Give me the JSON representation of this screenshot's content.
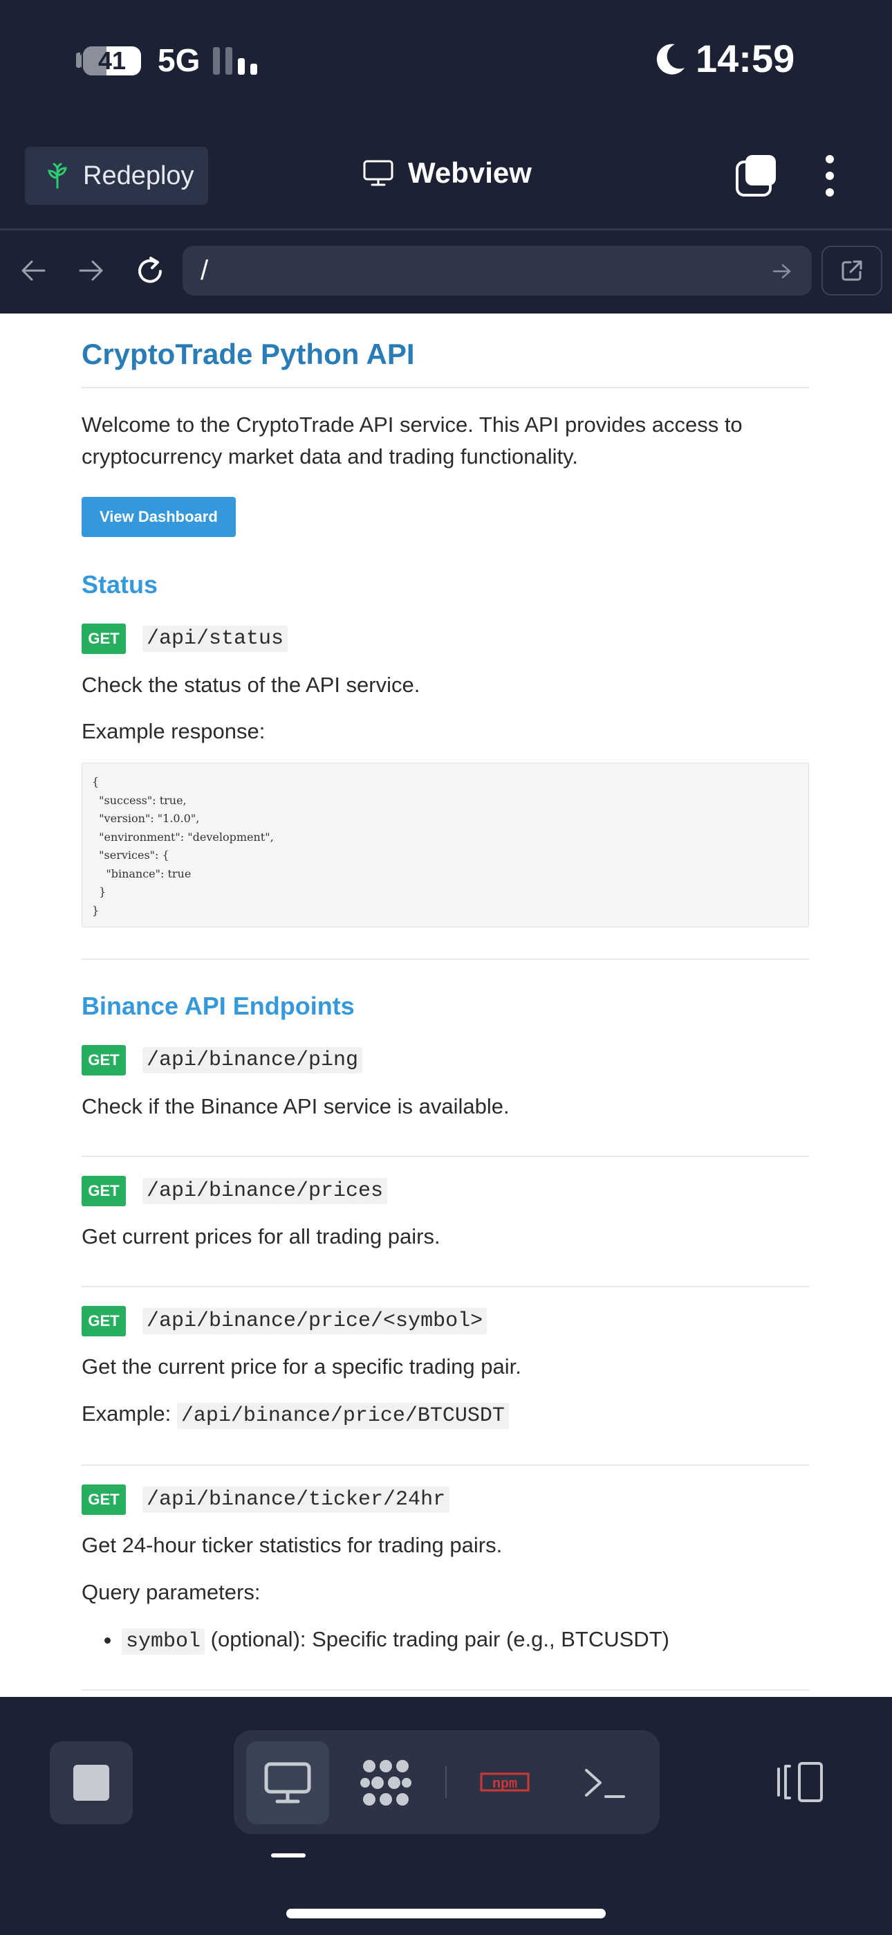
{
  "status_bar": {
    "battery": "41",
    "network": "5G",
    "time": "14:59"
  },
  "header": {
    "redeploy_label": "Redeploy",
    "title": "Webview"
  },
  "address": {
    "url": "/"
  },
  "page": {
    "title": "CryptoTrade Python API",
    "intro": "Welcome to the CryptoTrade API service. This API provides access to cryptocurrency market data and trading functionality.",
    "dashboard_button": "View Dashboard",
    "status_section": {
      "heading": "Status",
      "method": "GET",
      "path": "/api/status",
      "description": "Check the status of the API service.",
      "example_label": "Example response:",
      "example_json": "{\n  \"success\": true,\n  \"version\": \"1.0.0\",\n  \"environment\": \"development\",\n  \"services\": {\n    \"binance\": true\n  }\n}"
    },
    "binance_section": {
      "heading": "Binance API Endpoints",
      "endpoints": [
        {
          "method": "GET",
          "path": "/api/binance/ping",
          "description": "Check if the Binance API service is available."
        },
        {
          "method": "GET",
          "path": "/api/binance/prices",
          "description": "Get current prices for all trading pairs."
        },
        {
          "method": "GET",
          "path": "/api/binance/price/<symbol>",
          "description": "Get the current price for a specific trading pair.",
          "example_label": "Example:",
          "example_path": "/api/binance/price/BTCUSDT"
        },
        {
          "method": "GET",
          "path": "/api/binance/ticker/24hr",
          "description": "Get 24-hour ticker statistics for trading pairs.",
          "query_label": "Query parameters:",
          "param_name": "symbol",
          "param_desc": "(optional): Specific trading pair (e.g., BTCUSDT)"
        }
      ]
    }
  },
  "dock": {
    "items": [
      "preview-icon",
      "packages-icon",
      "npm-icon",
      "terminal-icon"
    ],
    "npm_label": "npm"
  },
  "colors": {
    "bg": "#1c2233",
    "heading": "#2a7cb7",
    "link": "#3498db",
    "get": "#27ae60",
    "npm": "#cb3837"
  }
}
